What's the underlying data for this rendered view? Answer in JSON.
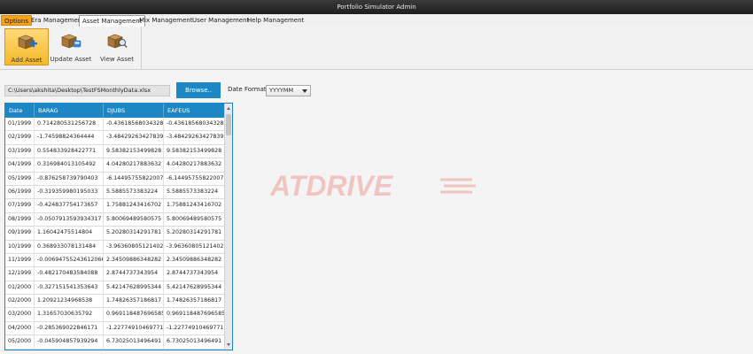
{
  "window": {
    "title": "Portfolio Simulator Admin"
  },
  "menu": {
    "tabs": [
      {
        "label": "Options"
      },
      {
        "label": "Era Management"
      },
      {
        "label": "Asset Management"
      },
      {
        "label": "Mix Management"
      },
      {
        "label": "User Management"
      },
      {
        "label": "Help Management"
      }
    ]
  },
  "ribbon": {
    "buttons": [
      {
        "label": "Add Asset",
        "icon": "add-asset-icon"
      },
      {
        "label": "Update Asset",
        "icon": "update-asset-icon"
      },
      {
        "label": "View Asset",
        "icon": "view-asset-icon"
      }
    ]
  },
  "file": {
    "path": "C:\\Users\\akshita\\Desktop\\TestFSMonthlyData.xlsx",
    "browse_label": "Browse..",
    "date_format_label": "Date Format",
    "date_format_value": "YYYYMM"
  },
  "table": {
    "columns": [
      "Date",
      "BARAG",
      "DJUBS",
      "EAFEUS"
    ],
    "rows": [
      [
        "01/1999",
        "0.714280531256728",
        "-0.436185680343282",
        "-0.436185680343282"
      ],
      [
        "02/1999",
        "-1.74598824364444",
        "-3.48429263427839",
        "-3.48429263427839"
      ],
      [
        "03/1999",
        "0.554833928422771",
        "9.58382153499828",
        "9.58382153499828"
      ],
      [
        "04/1999",
        "0.316984013105492",
        "4.04280217883632",
        "4.04280217883632"
      ],
      [
        "05/1999",
        "-0.876258739790403",
        "-6.14495755822007",
        "-6.14495755822007"
      ],
      [
        "06/1999",
        "-0.319359980195033",
        "5.5885573383224",
        "5.5885573383224"
      ],
      [
        "07/1999",
        "-0.424837754173657",
        "1.75881243416702",
        "1.75881243416702"
      ],
      [
        "08/1999",
        "-0.0507913593934317",
        "5.80069489580575",
        "5.80069489580575"
      ],
      [
        "09/1999",
        "1.16042475514804",
        "5.20280314291781",
        "5.20280314291781"
      ],
      [
        "10/1999",
        "0.368933078131484",
        "-3.96360805121402",
        "-3.96360805121402"
      ],
      [
        "11/1999",
        "-0.00694755243612066",
        "2.34509886348282",
        "2.34509886348282"
      ],
      [
        "12/1999",
        "-0.482170483584088",
        "2.8744737343954",
        "2.8744737343954"
      ],
      [
        "01/2000",
        "-0.327151541353643",
        "5.42147628995344",
        "5.42147628995344"
      ],
      [
        "02/2000",
        "1.20921234968538",
        "1.74826357186817",
        "1.74826357186817"
      ],
      [
        "03/2000",
        "1.31657030635792",
        "0.969118487696585",
        "0.969118487696585"
      ],
      [
        "04/2000",
        "-0.285369022846171",
        "-1.22774910469771",
        "-1.22774910469771"
      ],
      [
        "05/2000",
        "-0.045904857939294",
        "6.73025013496491",
        "6.73025013496491"
      ]
    ]
  },
  "watermark": {
    "text": "ATDRIVE",
    "color": "#e84a3c"
  },
  "colors": {
    "accent": "#1d87c5",
    "options_tab": "#f6a21a",
    "ribbon_selected": "#f6b82a"
  }
}
